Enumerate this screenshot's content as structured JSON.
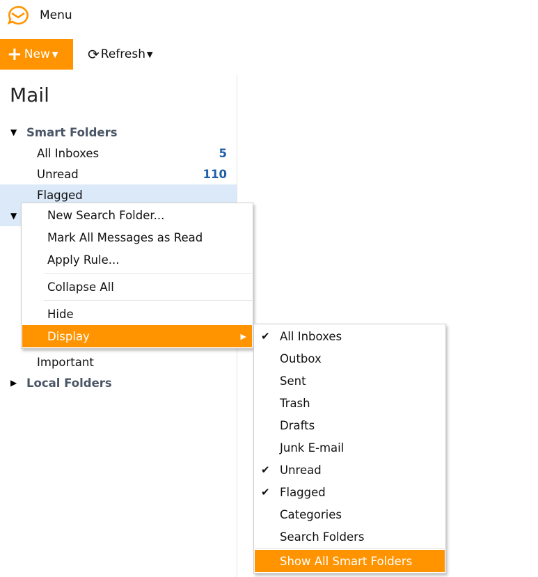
{
  "header": {
    "menu_label": "Menu",
    "brand_color": "#ff9400"
  },
  "toolbar": {
    "new_label": "New",
    "refresh_label": "Refresh"
  },
  "sidebar": {
    "title": "Mail",
    "smart_folders": {
      "label": "Smart Folders",
      "items": [
        {
          "label": "All Inboxes",
          "count": "5"
        },
        {
          "label": "Unread",
          "count": "110"
        },
        {
          "label": "Flagged",
          "count": ""
        }
      ]
    },
    "important_label": "Important",
    "local_folders_label": "Local Folders"
  },
  "context_menu": {
    "items": [
      "New Search Folder...",
      "Mark All Messages as Read",
      "Apply Rule...",
      "Collapse All",
      "Hide",
      "Display"
    ]
  },
  "display_submenu": {
    "items": [
      {
        "label": "All Inboxes",
        "checked": true
      },
      {
        "label": "Outbox",
        "checked": false
      },
      {
        "label": "Sent",
        "checked": false
      },
      {
        "label": "Trash",
        "checked": false
      },
      {
        "label": "Drafts",
        "checked": false
      },
      {
        "label": "Junk E-mail",
        "checked": false
      },
      {
        "label": "Unread",
        "checked": true
      },
      {
        "label": "Flagged",
        "checked": true
      },
      {
        "label": "Categories",
        "checked": false
      },
      {
        "label": "Search Folders",
        "checked": false
      }
    ],
    "show_all_label": "Show All Smart Folders"
  }
}
